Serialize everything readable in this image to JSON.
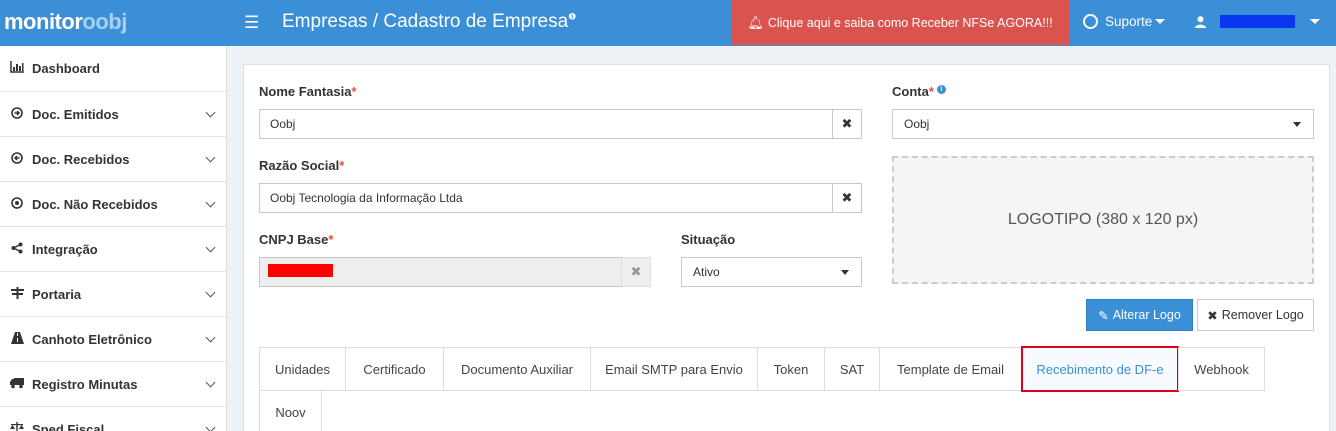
{
  "header": {
    "logo_main": "monitor",
    "logo_accent": "oobj",
    "breadcrumb": "Empresas / Cadastro de Empresa",
    "alert": "Clique aqui e saiba como Receber NFSe AGORA!!!",
    "support": "Suporte",
    "colors": {
      "topbar": "#3b8fd6",
      "alert": "#d9534f",
      "redaction": "#0a36f0"
    }
  },
  "sidebar": {
    "items": [
      {
        "label": "Dashboard",
        "icon": "bar-chart-icon"
      },
      {
        "label": "Doc. Emitidos",
        "icon": "arrow-circle-right-icon"
      },
      {
        "label": "Doc. Recebidos",
        "icon": "arrow-circle-left-icon"
      },
      {
        "label": "Doc. Não Recebidos",
        "icon": "dot-circle-icon"
      },
      {
        "label": "Integração",
        "icon": "share-icon"
      },
      {
        "label": "Portaria",
        "icon": "signpost-icon"
      },
      {
        "label": "Canhoto Eletrônico",
        "icon": "road-icon"
      },
      {
        "label": "Registro Minutas",
        "icon": "truck-icon"
      },
      {
        "label": "Sped Fiscal",
        "icon": "balance-scale-icon"
      }
    ]
  },
  "form": {
    "nome_fantasia": {
      "label": "Nome Fantasia",
      "required": "*",
      "value": "Oobj"
    },
    "razao_social": {
      "label": "Razão Social",
      "required": "*",
      "value": "Oobj Tecnologia da Informação Ltda"
    },
    "cnpj_base": {
      "label": "CNPJ Base",
      "required": "*"
    },
    "situacao": {
      "label": "Situação",
      "value": "Ativo"
    },
    "conta": {
      "label": "Conta",
      "required": "*",
      "value": "Oobj"
    },
    "clear_symbol": "✖"
  },
  "logo": {
    "placeholder": "LOGOTIPO (380 x 120 px)",
    "change_button": "Alterar Logo",
    "remove_button": "Remover Logo"
  },
  "tabs": [
    {
      "label": "Unidades"
    },
    {
      "label": "Certificado"
    },
    {
      "label": "Documento Auxiliar"
    },
    {
      "label": "Email SMTP para Envio"
    },
    {
      "label": "Token"
    },
    {
      "label": "SAT"
    },
    {
      "label": "Template de Email"
    },
    {
      "label": "Recebimento de DF-e"
    },
    {
      "label": "Webhook"
    },
    {
      "label": "Noov"
    }
  ],
  "active_tab": "Recebimento de DF-e"
}
